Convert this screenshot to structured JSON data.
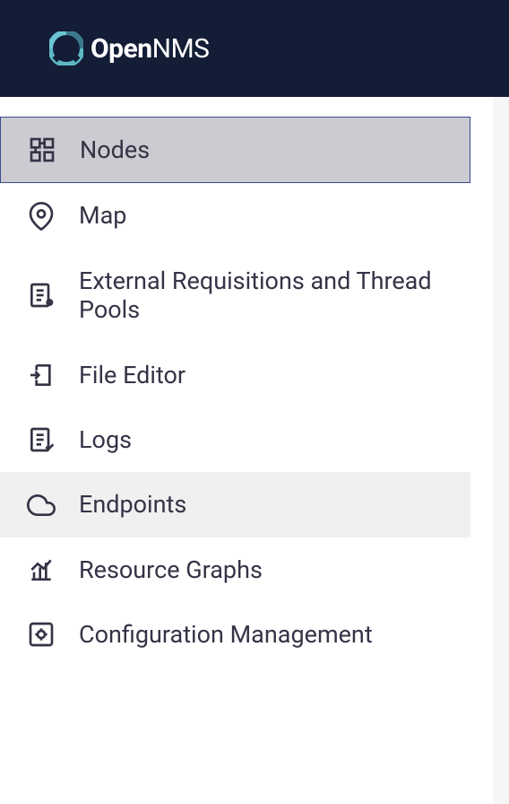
{
  "header": {
    "logo_text_bold": "Open",
    "logo_text_regular": "NMS"
  },
  "sidebar": {
    "items": [
      {
        "label": "Nodes",
        "icon": "nodes-icon",
        "active": true
      },
      {
        "label": "Map",
        "icon": "map-pin-icon",
        "active": false
      },
      {
        "label": "External Requisitions and Thread Pools",
        "icon": "requisitions-icon",
        "active": false
      },
      {
        "label": "File Editor",
        "icon": "file-editor-icon",
        "active": false
      },
      {
        "label": "Logs",
        "icon": "logs-icon",
        "active": false
      },
      {
        "label": "Endpoints",
        "icon": "cloud-icon",
        "active": false,
        "hovered": true
      },
      {
        "label": "Resource Graphs",
        "icon": "chart-icon",
        "active": false
      },
      {
        "label": "Configuration Management",
        "icon": "config-icon",
        "active": false
      }
    ]
  }
}
